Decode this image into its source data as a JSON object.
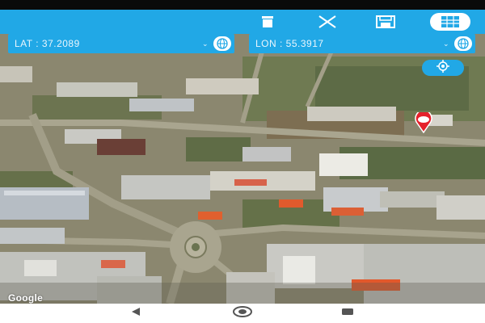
{
  "toolbar": {
    "icons": [
      "trash-icon",
      "close-icon",
      "save-icon",
      "map-list-icon"
    ]
  },
  "coordinates": {
    "lat_text": "LAT : 37.2089",
    "lon_text": "LON : 55.3917"
  },
  "map": {
    "attribution": "Google",
    "marker": "location-pin-icon"
  },
  "navigation": {
    "icons": [
      "back-icon",
      "home-icon",
      "recents-icon"
    ]
  },
  "colors": {
    "accent": "#21a8e6",
    "marker": "#e5212b",
    "navbar": "#ffffff"
  }
}
